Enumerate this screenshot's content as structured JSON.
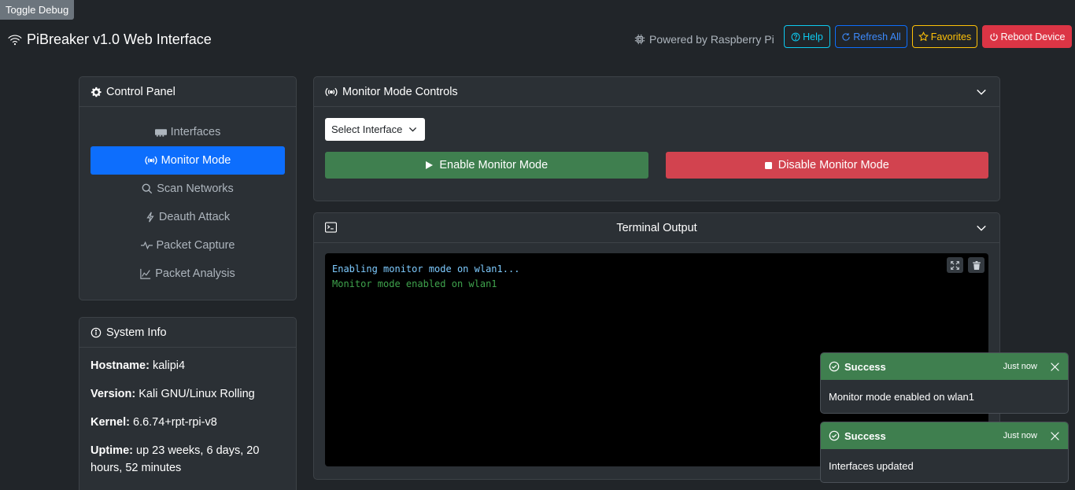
{
  "debug": {
    "label": "Toggle Debug"
  },
  "header": {
    "title": "PiBreaker v1.0 Web Interface",
    "powered_by": "Powered by Raspberry Pi",
    "buttons": {
      "help": "Help",
      "refresh": "Refresh All",
      "favorites": "Favorites",
      "reboot": "Reboot Device"
    }
  },
  "control_panel": {
    "title": "Control Panel",
    "items": [
      {
        "label": "Interfaces",
        "icon": "ethernet-card-icon"
      },
      {
        "label": "Monitor Mode",
        "icon": "broadcast-icon",
        "active": true
      },
      {
        "label": "Scan Networks",
        "icon": "search-icon"
      },
      {
        "label": "Deauth Attack",
        "icon": "lightning-icon"
      },
      {
        "label": "Packet Capture",
        "icon": "pulse-icon"
      },
      {
        "label": "Packet Analysis",
        "icon": "graph-icon"
      }
    ]
  },
  "system_info": {
    "title": "System Info",
    "rows": [
      {
        "key": "Hostname:",
        "value": "kalipi4"
      },
      {
        "key": "Version:",
        "value": "Kali GNU/Linux Rolling"
      },
      {
        "key": "Kernel:",
        "value": "6.6.74+rpt-rpi-v8"
      },
      {
        "key": "Uptime:",
        "value": "up 23 weeks, 6 days, 20 hours, 52 minutes"
      }
    ]
  },
  "monitor": {
    "title": "Monitor Mode Controls",
    "select_label": "Select Interface",
    "enable_label": "Enable Monitor Mode",
    "disable_label": "Disable Monitor Mode"
  },
  "terminal": {
    "title": "Terminal Output",
    "lines": [
      {
        "text": "Enabling monitor mode on wlan1...",
        "style": "info"
      },
      {
        "text": "Monitor mode enabled on wlan1",
        "style": "success"
      }
    ]
  },
  "toasts": [
    {
      "title": "Success",
      "time": "Just now",
      "message": "Monitor mode enabled on wlan1"
    },
    {
      "title": "Success",
      "time": "Just now",
      "message": "Interfaces updated"
    }
  ],
  "colors": {
    "accent": "#0d6efd",
    "success": "#3f7f4f",
    "danger": "#d2434f",
    "background": "#212529"
  }
}
